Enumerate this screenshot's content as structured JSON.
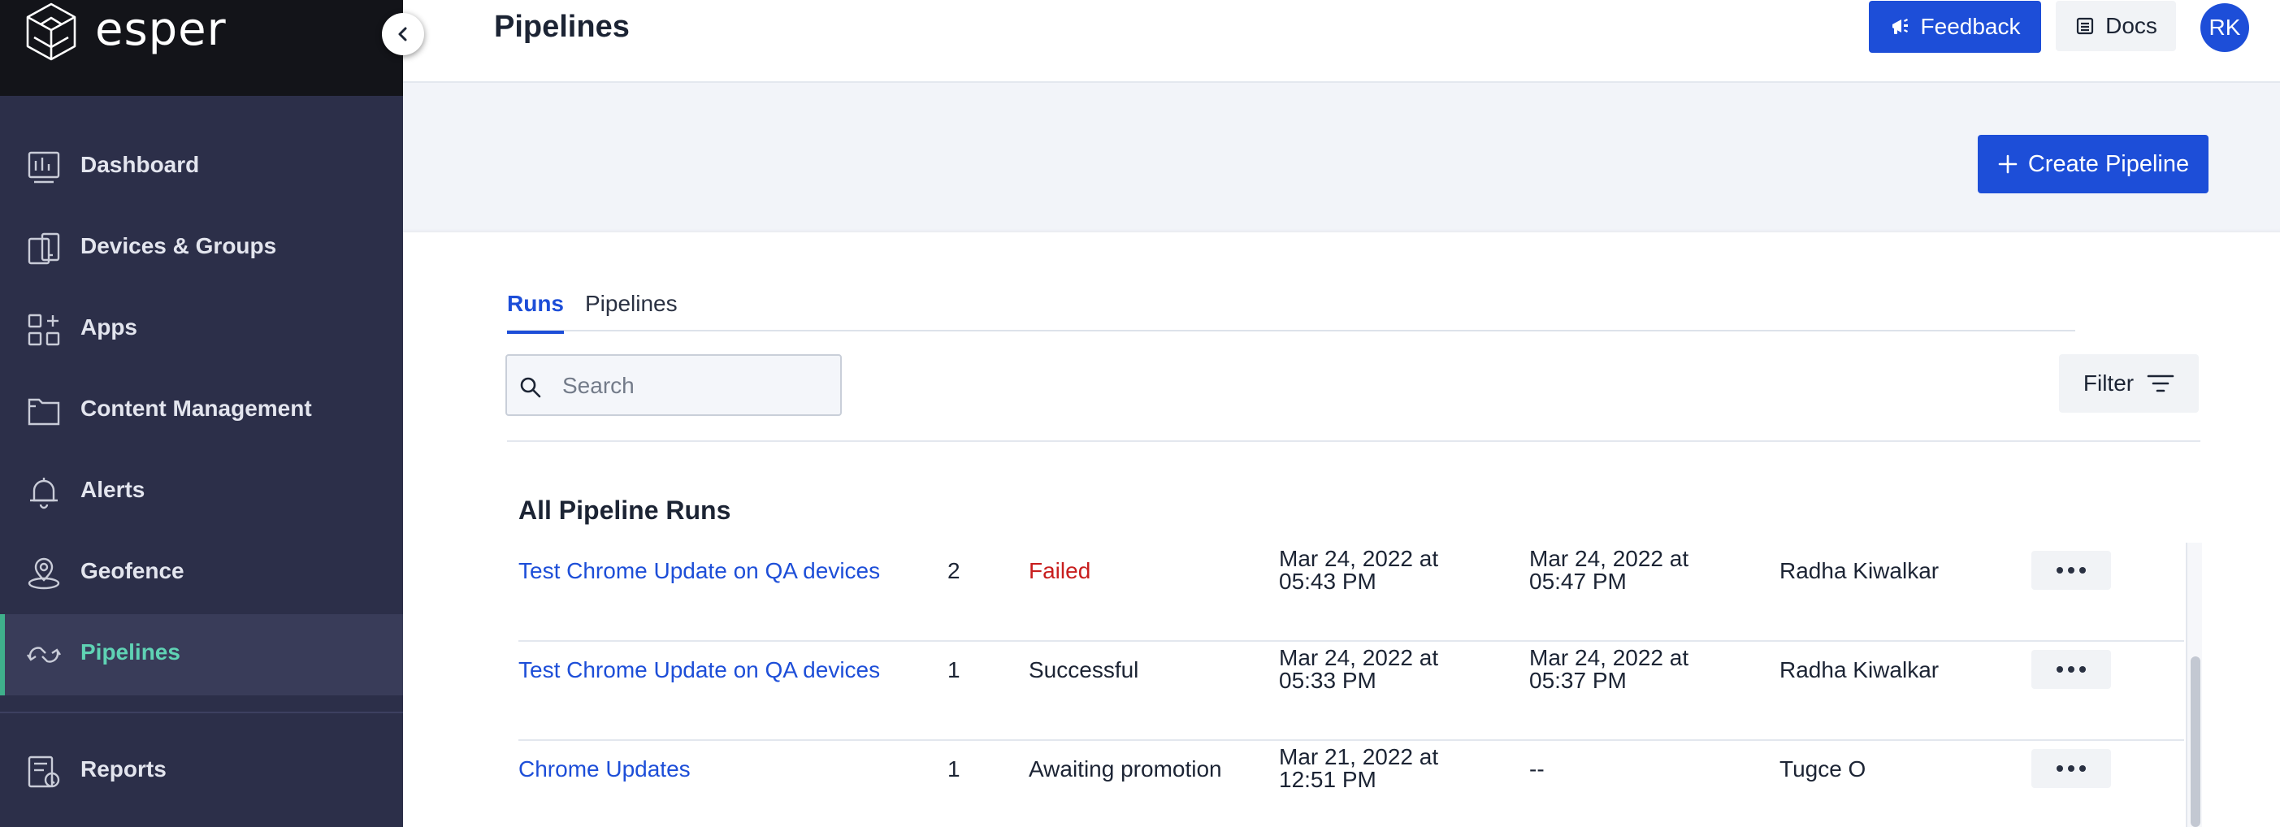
{
  "brand": {
    "name": "esper"
  },
  "sidebar": {
    "items": [
      {
        "label": "Dashboard",
        "icon": "dashboard-icon"
      },
      {
        "label": "Devices & Groups",
        "icon": "devices-icon"
      },
      {
        "label": "Apps",
        "icon": "apps-icon"
      },
      {
        "label": "Content Management",
        "icon": "folder-icon"
      },
      {
        "label": "Alerts",
        "icon": "bell-icon"
      },
      {
        "label": "Geofence",
        "icon": "geofence-icon"
      },
      {
        "label": "Pipelines",
        "icon": "pipelines-icon",
        "active": true
      },
      {
        "label": "Reports",
        "icon": "reports-icon"
      }
    ]
  },
  "header": {
    "title": "Pipelines",
    "feedback_label": "Feedback",
    "docs_label": "Docs",
    "avatar_initials": "RK"
  },
  "actions": {
    "create_label": "Create Pipeline"
  },
  "tabs": [
    {
      "label": "Runs",
      "active": true
    },
    {
      "label": "Pipelines",
      "active": false
    }
  ],
  "search": {
    "placeholder": "Search",
    "value": ""
  },
  "filter": {
    "label": "Filter"
  },
  "runs": {
    "title": "All Pipeline Runs",
    "rows": [
      {
        "name": "Test Chrome Update on QA devices",
        "number": "2",
        "status": "Failed",
        "started_line1": "Mar 24, 2022 at",
        "started_line2": "05:43 PM",
        "ended_line1": "Mar 24, 2022 at",
        "ended_line2": "05:47 PM",
        "user": "Radha Kiwalkar"
      },
      {
        "name": "Test Chrome Update on QA devices",
        "number": "1",
        "status": "Successful",
        "started_line1": "Mar 24, 2022 at",
        "started_line2": "05:33 PM",
        "ended_line1": "Mar 24, 2022 at",
        "ended_line2": "05:37 PM",
        "user": "Radha Kiwalkar"
      },
      {
        "name": "Chrome Updates",
        "number": "1",
        "status": "Awaiting promotion",
        "started_line1": "Mar 21, 2022 at",
        "started_line2": "12:51 PM",
        "ended_line1": "--",
        "ended_line2": "",
        "user": "Tugce O"
      }
    ]
  },
  "colors": {
    "accent": "#1d4ed8",
    "sidebar_bg": "#2c2f49",
    "active_nav": "#5fd3b4",
    "failed": "#c81e1e"
  }
}
